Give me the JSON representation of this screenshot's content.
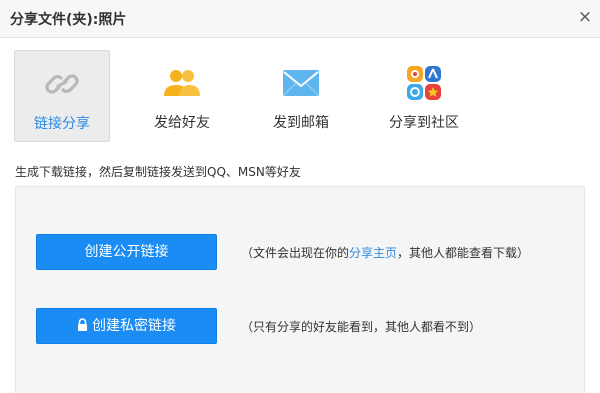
{
  "dialog": {
    "title": "分享文件(夹):照片",
    "close_glyph": "×"
  },
  "tabs": [
    {
      "label": "链接分享",
      "icon": "link-icon",
      "active": true
    },
    {
      "label": "发给好友",
      "icon": "friends-icon",
      "active": false
    },
    {
      "label": "发到邮箱",
      "icon": "mail-icon",
      "active": false
    },
    {
      "label": "分享到社区",
      "icon": "community-icon",
      "active": false
    }
  ],
  "hint": "生成下载链接，然后复制链接发送到QQ、MSN等好友",
  "public_link": {
    "button_label": "创建公开链接",
    "note_prefix": "（文件会出现在你的",
    "note_link": "分享主页",
    "note_suffix": "，其他人都能查看下载）"
  },
  "private_link": {
    "button_label": "创建私密链接",
    "note": "（只有分享的好友能看到，其他人都看不到）"
  },
  "colors": {
    "accent": "#1a8cf3",
    "link": "#2a8ae1",
    "panel_bg": "#f5f5f5"
  }
}
